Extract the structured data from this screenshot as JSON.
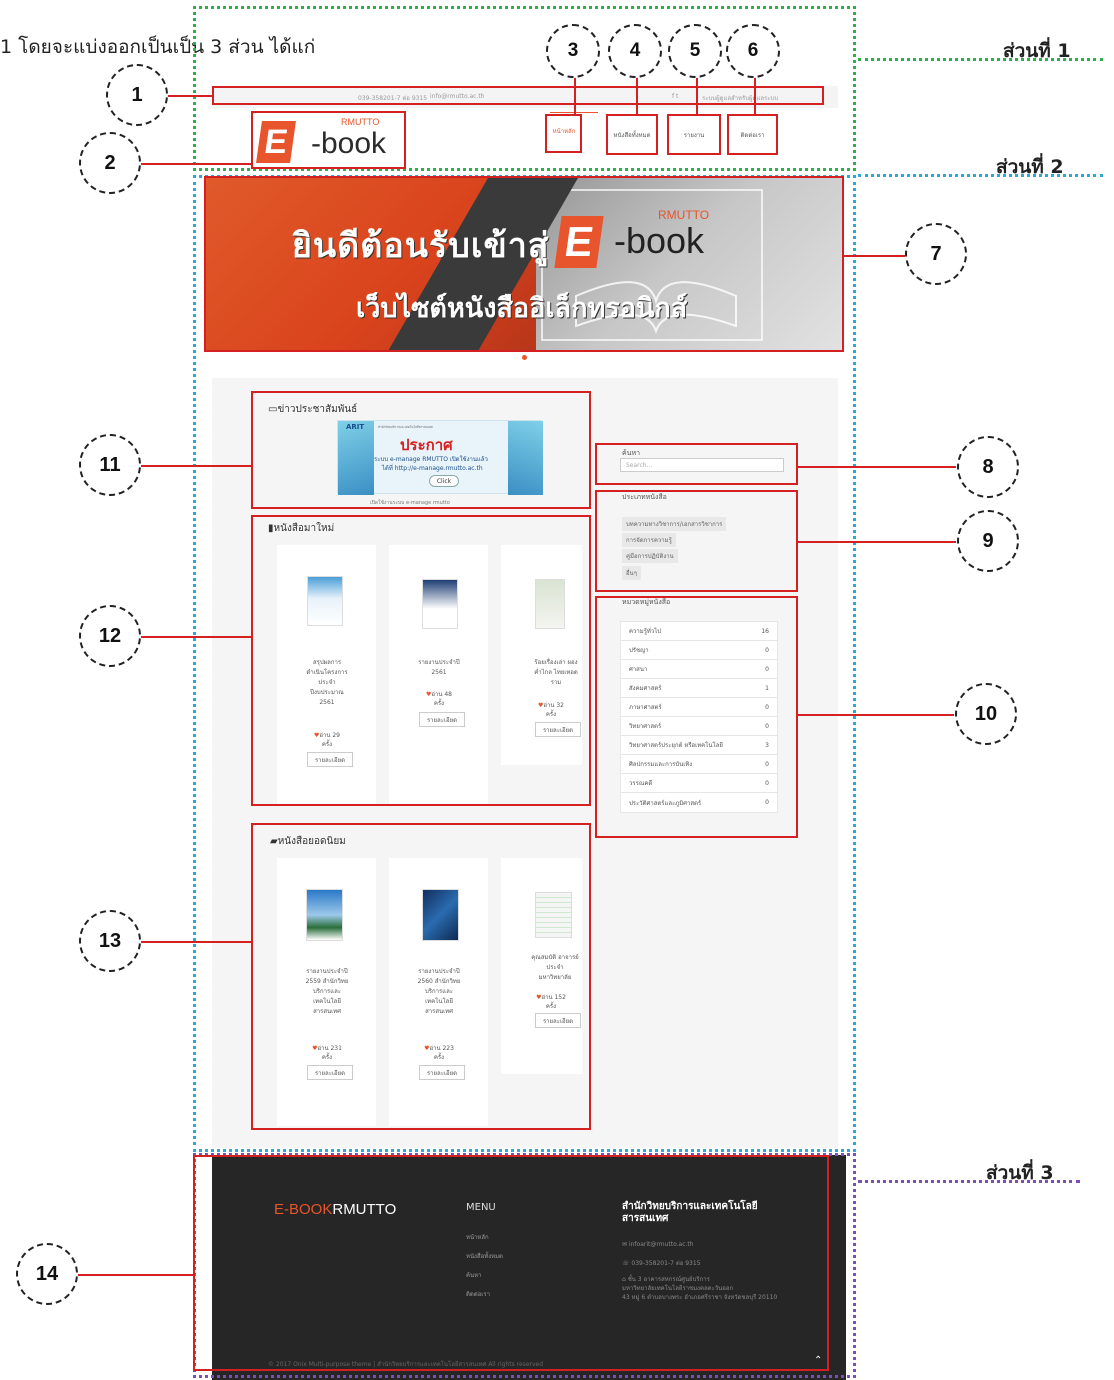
{
  "intro_text": "1 โดยจะแบ่งออกเป็นเป็น 3 ส่วน ได้แก่",
  "section_labels": [
    "ส่วนที่ 1",
    "ส่วนที่ 2",
    "ส่วนที่ 3"
  ],
  "callouts": [
    "1",
    "2",
    "3",
    "4",
    "5",
    "6",
    "7",
    "8",
    "9",
    "10",
    "11",
    "12",
    "13",
    "14"
  ],
  "topbar": {
    "phone": "039-358201-7 ต่อ 9315",
    "email": "info@rmutto.ac.th",
    "social": "f  t",
    "right_link": "ระบบผู้ดูแลสำหรับผู้ดูแลระบบ"
  },
  "logo": {
    "rmutto": "RMUTTO",
    "e": "E",
    "book": "-book"
  },
  "nav": [
    {
      "label": "หน้าหลัก",
      "active": true
    },
    {
      "label": "หนังสือทั้งหมด",
      "active": false
    },
    {
      "label": "รายงาน",
      "active": false
    },
    {
      "label": "ติดต่อเรา",
      "active": false
    }
  ],
  "banner": {
    "title": "ยินดีต้อนรับเข้าสู่",
    "subtitle": "เว็บไซต์หนังสืออิเล็กทรอนิกส์",
    "e": "E",
    "book": "-book",
    "rmutto": "RMUTTO"
  },
  "news": {
    "title": "ข่าวประชาสัมพันธ์",
    "banner_small": "สำนักวิทยบริการและเทคโนโลยีสารสนเทศ",
    "announce": "ประกาศ",
    "line1": "ระบบ e-manage RMUTTO เปิดใช้งานแล้ว",
    "line2": "ได้ที่ http://e-manage.rmutto.ac.th",
    "click": "Click",
    "caption": "เปิดใช้งานระบบ e-manage rmutto"
  },
  "new_books": {
    "title": "หนังสือมาใหม่",
    "items": [
      {
        "title": "สรุปผลการดำเนินโครงการ ประจำปีงบประมาณ 2561",
        "reads": "อ่าน 29",
        "unit": "ครั้ง",
        "button": "รายละเอียด"
      },
      {
        "title": "รายงานประจำปี 2561",
        "reads": "อ่าน 48",
        "unit": "ครั้ง",
        "button": "รายละเอียด"
      },
      {
        "title": "ร้อยเรื่องเล่า ผองค่ำไกล ไทยเทอดราม",
        "reads": "อ่าน 32",
        "unit": "ครั้ง",
        "button": "รายละเอียด"
      }
    ]
  },
  "popular_books": {
    "title": "หนังสือยอดนิยม",
    "items": [
      {
        "title": "รายงานประจำปี 2559 สำนักวิทยบริการและเทคโนโลยีสารสนเทศ",
        "reads": "อ่าน 231",
        "unit": "ครั้ง",
        "button": "รายละเอียด"
      },
      {
        "title": "รายงานประจำปี 2560 สำนักวิทยบริการและเทคโนโลยีสารสนเทศ",
        "reads": "อ่าน 223",
        "unit": "ครั้ง",
        "button": "รายละเอียด"
      },
      {
        "title": "คุณสมบัติ อาจารย์ประจำ มหาวิทยาลัย",
        "reads": "อ่าน 152",
        "unit": "ครั้ง",
        "button": "รายละเอียด"
      }
    ]
  },
  "search": {
    "label": "ค้นหา",
    "placeholder": "Search..."
  },
  "book_types": {
    "title": "ประเภทหนังสือ",
    "items": [
      "บทความทางวิชาการ/เอกสารวิชาการ",
      "การจัดการความรู้",
      "คู่มือการปฏิบัติงาน",
      "อื่นๆ"
    ]
  },
  "categories": {
    "title": "หมวดหมู่หนังสือ",
    "items": [
      {
        "name": "ความรู้ทั่วไป",
        "count": "16"
      },
      {
        "name": "ปรัชญา",
        "count": "0"
      },
      {
        "name": "ศาสนา",
        "count": "0"
      },
      {
        "name": "สังคมศาสตร์",
        "count": "1"
      },
      {
        "name": "ภาษาศาสตร์",
        "count": "0"
      },
      {
        "name": "วิทยาศาสตร์",
        "count": "0"
      },
      {
        "name": "วิทยาศาสตร์ประยุกต์ หรือเทคโนโลยี",
        "count": "3"
      },
      {
        "name": "ศิลปกรรมและการบันเทิง",
        "count": "0"
      },
      {
        "name": "วรรณคดี",
        "count": "0"
      },
      {
        "name": "ประวัติศาสตร์และภูมิศาสตร์",
        "count": "0"
      }
    ]
  },
  "footer": {
    "brand_a": "E-BOOK",
    "brand_b": "RMUTTO",
    "menu_title": "MENU",
    "menu": [
      "หน้าหลัก",
      "หนังสือทั้งหมด",
      "ค้นหา",
      "ติดต่อเรา"
    ],
    "org_title": "สำนักวิทยบริการและเทคโนโลยีสารสนเทศ",
    "email": "infoarit@rmutto.ac.th",
    "phone": "039-358201-7 ต่อ 9315",
    "addr1": "ชั้น 3 อาคารสหกรณ์ศูนย์บริการ",
    "addr2": "มหาวิทยาลัยเทคโนโลยีราชมงคลตะวันออก",
    "addr3": "43 หมู่ 6 ตำบลบางพระ อำเภอศรีราชา จังหวัดชลบุรี 20110",
    "copyright": "© 2017 Onix Multi-purpose theme | สำนักวิทยบริการและเทคโนโลยีสารสนเทศ All rights reserved"
  },
  "colors": {
    "accent": "#e8542b",
    "callout_line": "#d42020",
    "frame1": "#2bb04a",
    "frame2": "#2aa8d8",
    "frame3": "#7b4fb5",
    "footer_bg": "#262626"
  }
}
